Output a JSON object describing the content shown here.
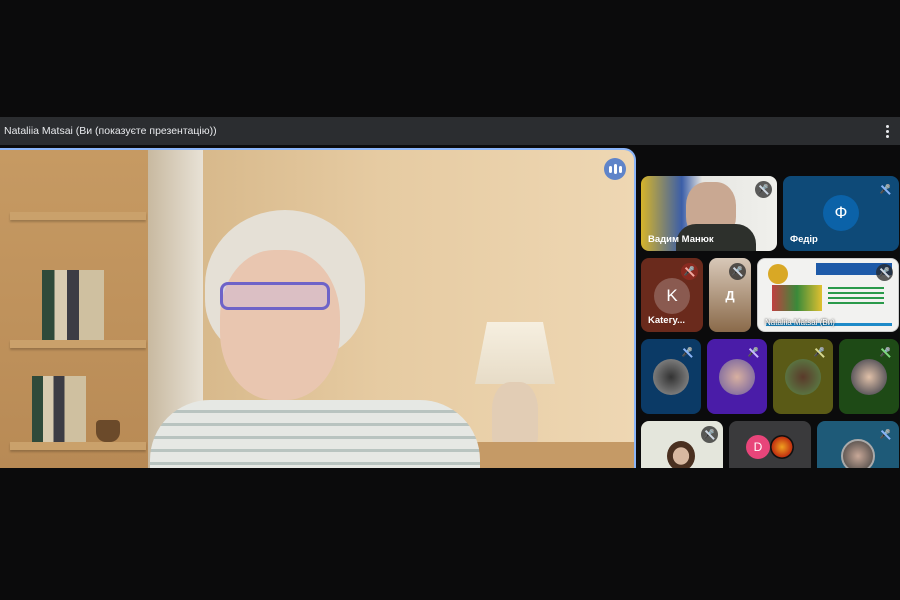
{
  "header": {
    "title": "Nataliia Matsai (Ви (показуєте презентацію))"
  },
  "participants": [
    {
      "name": "Вадим Манюк"
    },
    {
      "name": "Федір",
      "initial": "Ф"
    },
    {
      "name": "Kateгy...",
      "initial": "K"
    },
    {
      "initial": "Д"
    },
    {
      "caption": "Nataliia Matsai (Ви)"
    },
    {
      "initial": "D"
    }
  ],
  "colors": {
    "accent": "#8ab4f8",
    "bar": "#2b2d30"
  }
}
